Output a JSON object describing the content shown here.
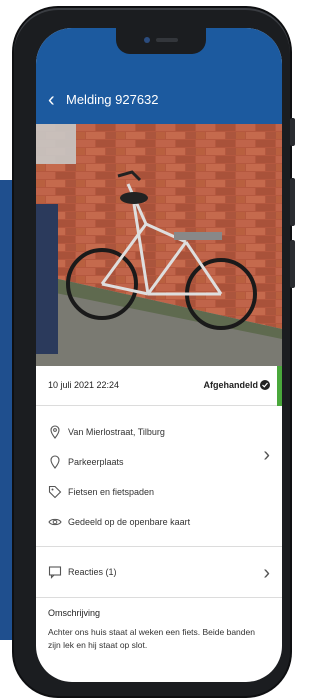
{
  "header": {
    "back_icon": "chevron-left-icon",
    "title": "Melding 927632"
  },
  "status": {
    "date": "10 juli 2021 22:24",
    "label": "Afgehandeld",
    "accent": "#4aa83c"
  },
  "details": [
    {
      "icon": "location-pin-icon",
      "label": "Van Mierlostraat, Tilburg"
    },
    {
      "icon": "location-pin-icon",
      "label": "Parkeerplaats"
    },
    {
      "icon": "tag-icon",
      "label": "Fietsen en fietspaden"
    },
    {
      "icon": "eye-icon",
      "label": "Gedeeld op de openbare kaart"
    }
  ],
  "reactions": {
    "icon": "chat-icon",
    "label": "Reacties (1)"
  },
  "description": {
    "heading": "Omschrijving",
    "text": "Achter ons huis staat al weken een fiets. Beide banden zijn lek en hij staat op slot."
  },
  "colors": {
    "appbar": "#1c5a9f",
    "brand_blue": "#1f4f8e"
  }
}
